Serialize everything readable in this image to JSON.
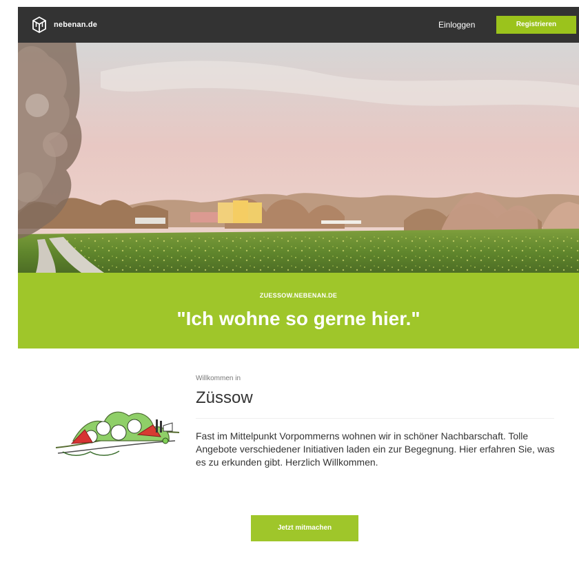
{
  "header": {
    "logo_text": "nebenan.de",
    "login_label": "Einloggen",
    "register_label": "Registrieren",
    "logo_icon": "cube-icon",
    "brand_color": "#9bc31c",
    "header_color": "#333333"
  },
  "hero": {
    "image_description": "field-landscape"
  },
  "banner": {
    "kicker": "ZUESSOW.NEBENAN.DE",
    "quote": "\"Ich wohne so gerne hier.\""
  },
  "content": {
    "welcome": "Willkommen in",
    "place": "Züssow",
    "description": "Fast im Mittelpunkt Vorpommerns wohnen wir in schöner Nachbarschaft. Tolle Angebote verschiedener Initiativen laden ein zur Begegnung. Hier erfahren Sie, was es zu erkunden gibt. Herzlich Willkommen.",
    "cta_label": "Jetzt mitmachen",
    "illustration_icon": "village-illustration-icon"
  }
}
